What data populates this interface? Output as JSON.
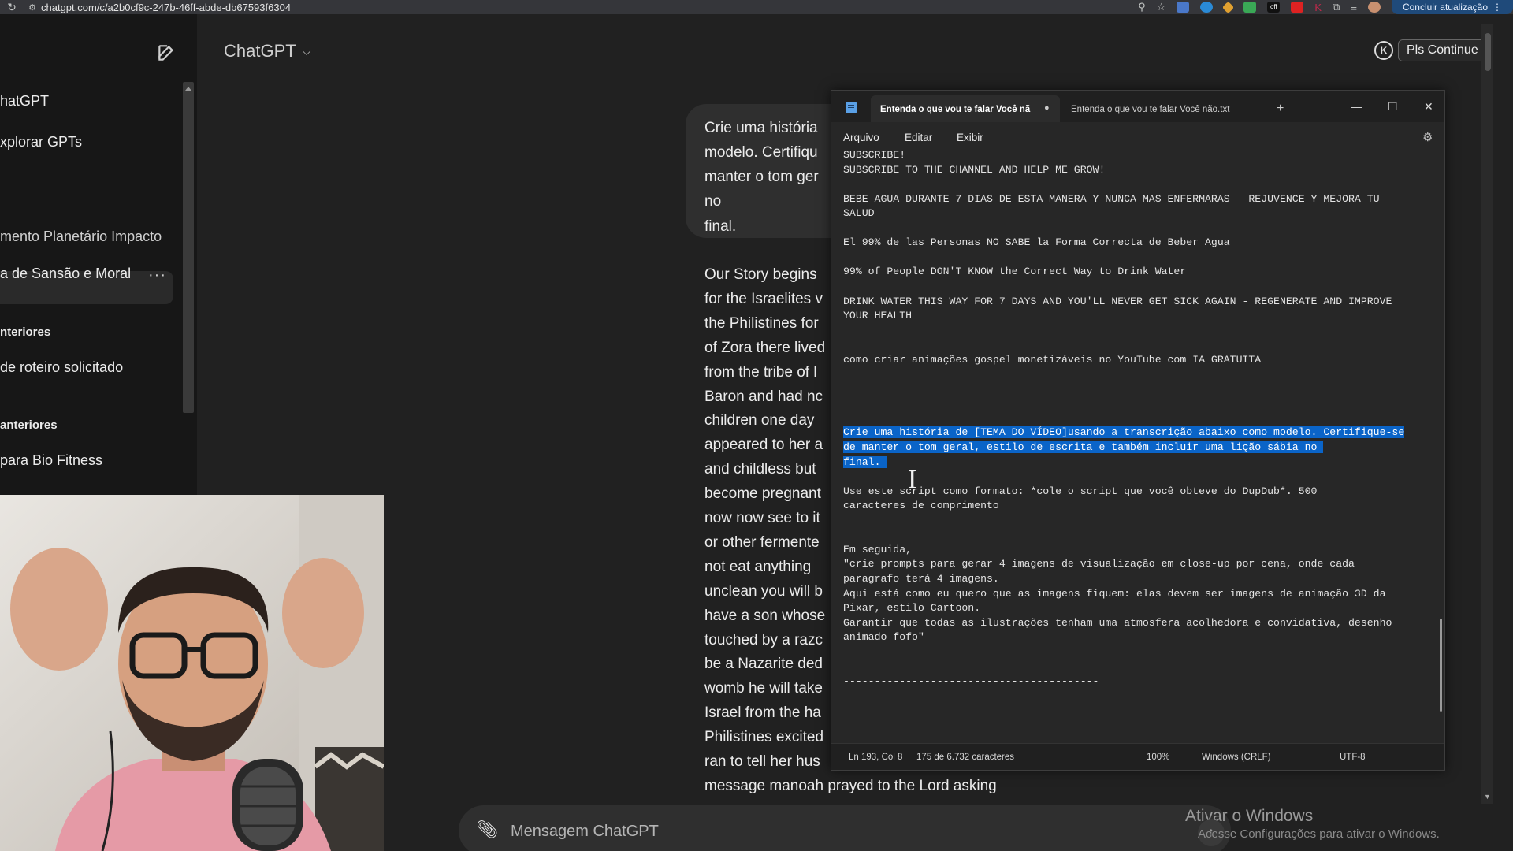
{
  "browser": {
    "url": "chatgpt.com/c/a2b0cf9c-247b-46ff-abde-db67593f6304",
    "update_label": "Concluir atualização",
    "extension_badge": "off"
  },
  "sidebar": {
    "items": [
      {
        "label": "hatGPT",
        "top": 0
      },
      {
        "label": "xplorar GPTs"
      }
    ],
    "recent": [
      {
        "label": "mento Planetário Impacto"
      },
      {
        "label": "a de Sansão e Moral"
      }
    ],
    "section1_header": "nteriores",
    "section1_items": [
      {
        "label": "de roteiro solicitado"
      }
    ],
    "section2_header": "anteriores",
    "section2_items": [
      {
        "label": "para Bio Fitness"
      }
    ]
  },
  "chat": {
    "title": "ChatGPT",
    "pls_continue": "Pls Continue",
    "k_badge": "K",
    "user_message_lines": [
      "Crie uma história",
      "modelo. Certifiqu",
      "manter o tom ger",
      "no",
      "final."
    ],
    "assistant_lines": [
      "Our Story begins",
      "for the Israelites v",
      "the Philistines for",
      "of Zora there lived",
      "from the tribe of l",
      "Baron and had nc",
      "children one day",
      "appeared to her a",
      "and childless but",
      "become pregnant",
      "now now see to it",
      "or other fermente",
      "not eat anything",
      "unclean you will b",
      "have a son whose",
      "touched by a razc",
      "be a Nazarite ded",
      "womb he will take",
      "Israel from the ha",
      "Philistines excited",
      "ran to tell her hus",
      "message manoah prayed to the Lord asking"
    ],
    "composer_placeholder": "Mensagem ChatGPT",
    "watermark_title": "Ativar o Windows",
    "watermark_sub": "Acesse Configurações para ativar o Windows."
  },
  "notepad": {
    "tab_active": "Entenda o que vou te falar Você nã",
    "tab_inactive": "Entenda o que vou te falar Você não.txt",
    "menu": [
      "Arquivo",
      "Editar",
      "Exibir"
    ],
    "lines": [
      {
        "text": "SUBSCRIBE!",
        "sel": false
      },
      {
        "text": "SUBSCRIBE TO THE CHANNEL AND HELP ME GROW!",
        "sel": false
      },
      {
        "text": "",
        "sel": false
      },
      {
        "text": "BEBE AGUA DURANTE 7 DIAS DE ESTA MANERA Y NUNCA MAS ENFERMARAS - REJUVENCE Y MEJORA TU",
        "sel": false
      },
      {
        "text": "SALUD",
        "sel": false
      },
      {
        "text": "",
        "sel": false
      },
      {
        "text": "El 99% de las Personas NO SABE la Forma Correcta de Beber Agua",
        "sel": false
      },
      {
        "text": "",
        "sel": false
      },
      {
        "text": "99% of People DON'T KNOW the Correct Way to Drink Water",
        "sel": false
      },
      {
        "text": "",
        "sel": false
      },
      {
        "text": "DRINK WATER THIS WAY FOR 7 DAYS AND YOU'LL NEVER GET SICK AGAIN - REGENERATE AND IMPROVE",
        "sel": false
      },
      {
        "text": "YOUR HEALTH",
        "sel": false
      },
      {
        "text": "",
        "sel": false
      },
      {
        "text": "",
        "sel": false
      },
      {
        "text": "como criar animações gospel monetizáveis no YouTube com IA GRATUITA",
        "sel": false
      },
      {
        "text": "",
        "sel": false
      },
      {
        "text": "",
        "sel": false
      },
      {
        "text": "-------------------------------------",
        "sel": false
      },
      {
        "text": "",
        "sel": false
      },
      {
        "text": "Crie uma história de [TEMA DO VÍDEO]usando a transcrição abaixo como modelo. Certifique-se",
        "sel": true
      },
      {
        "text": "de manter o tom geral, estilo de escrita e também incluir uma lição sábia no ",
        "sel": true
      },
      {
        "text": "final. ",
        "sel": true
      },
      {
        "text": "",
        "sel": false
      },
      {
        "text": "Use este script como formato: *cole o script que você obteve do DupDub*. 500",
        "sel": false
      },
      {
        "text": "caracteres de comprimento",
        "sel": false
      },
      {
        "text": "",
        "sel": false
      },
      {
        "text": "",
        "sel": false
      },
      {
        "text": "Em seguida,",
        "sel": false
      },
      {
        "text": "\"crie prompts para gerar 4 imagens de visualização em close-up por cena, onde cada",
        "sel": false
      },
      {
        "text": "paragrafo terá 4 imagens.",
        "sel": false
      },
      {
        "text": "Aqui está como eu quero que as imagens fiquem: elas devem ser imagens de animação 3D da",
        "sel": false
      },
      {
        "text": "Pixar, estilo Cartoon.",
        "sel": false
      },
      {
        "text": "Garantir que todas as ilustrações tenham uma atmosfera acolhedora e convidativa, desenho",
        "sel": false
      },
      {
        "text": "animado fofo\"",
        "sel": false
      },
      {
        "text": "",
        "sel": false
      },
      {
        "text": "",
        "sel": false
      },
      {
        "text": "-----------------------------------------",
        "sel": false
      }
    ],
    "status": {
      "position": "Ln 193, Col 8",
      "chars": "175 de 6.732 caracteres",
      "zoom": "100%",
      "line_ending": "Windows (CRLF)",
      "encoding": "UTF-8"
    }
  },
  "colors": {
    "selection": "#0a64c8",
    "chat_bg": "#212121",
    "sidebar_bg": "#171717"
  }
}
